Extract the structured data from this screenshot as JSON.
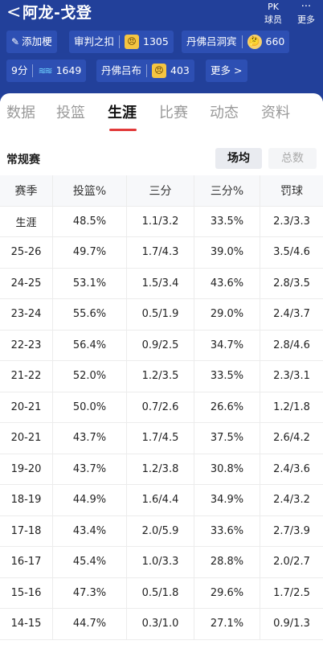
{
  "header": {
    "back_glyph": "<",
    "title": "阿龙-戈登",
    "pk_glyph": "PK",
    "pk_label": "球员",
    "more_glyph": "···",
    "more_label": "更多"
  },
  "chips": {
    "add_tag": "添加梗",
    "judge_label": "审判之扣",
    "judge_count": "1305",
    "dunk_label": "丹佛吕洞宾",
    "dunk_count": "660",
    "score_label": "9分",
    "score_count": "1649",
    "dunk2_label": "丹佛吕布",
    "dunk2_count": "403",
    "more_label": "更多",
    "more_chevron": ">"
  },
  "tabs": [
    "数据",
    "投篮",
    "生涯",
    "比赛",
    "动态",
    "资料"
  ],
  "active_tab": "生涯",
  "section": {
    "title": "常规赛",
    "toggle_on": "场均",
    "toggle_off": "总数"
  },
  "table": {
    "columns": [
      "赛季",
      "投篮%",
      "三分",
      "三分%",
      "罚球"
    ],
    "rows": [
      [
        "生涯",
        "48.5%",
        "1.1/3.2",
        "33.5%",
        "2.3/3.3"
      ],
      [
        "25-26",
        "49.7%",
        "1.7/4.3",
        "39.0%",
        "3.5/4.6"
      ],
      [
        "24-25",
        "53.1%",
        "1.5/3.4",
        "43.6%",
        "2.8/3.5"
      ],
      [
        "23-24",
        "55.6%",
        "0.5/1.9",
        "29.0%",
        "2.4/3.7"
      ],
      [
        "22-23",
        "56.4%",
        "0.9/2.5",
        "34.7%",
        "2.8/4.6"
      ],
      [
        "21-22",
        "52.0%",
        "1.2/3.5",
        "33.5%",
        "2.3/3.1"
      ],
      [
        "20-21",
        "50.0%",
        "0.7/2.6",
        "26.6%",
        "1.2/1.8"
      ],
      [
        "20-21",
        "43.7%",
        "1.7/4.5",
        "37.5%",
        "2.6/4.2"
      ],
      [
        "19-20",
        "43.7%",
        "1.2/3.8",
        "30.8%",
        "2.4/3.6"
      ],
      [
        "18-19",
        "44.9%",
        "1.6/4.4",
        "34.9%",
        "2.4/3.2"
      ],
      [
        "17-18",
        "43.4%",
        "2.0/5.9",
        "33.6%",
        "2.7/3.9"
      ],
      [
        "16-17",
        "45.4%",
        "1.0/3.3",
        "28.8%",
        "2.0/2.7"
      ],
      [
        "15-16",
        "47.3%",
        "0.5/1.8",
        "29.6%",
        "1.7/2.5"
      ],
      [
        "14-15",
        "44.7%",
        "0.3/1.0",
        "27.1%",
        "0.9/1.3"
      ]
    ]
  },
  "colors": {
    "header_bg": "#22409a",
    "chip_bg": "#2d4fb3",
    "active_underline": "#e23a3a"
  }
}
